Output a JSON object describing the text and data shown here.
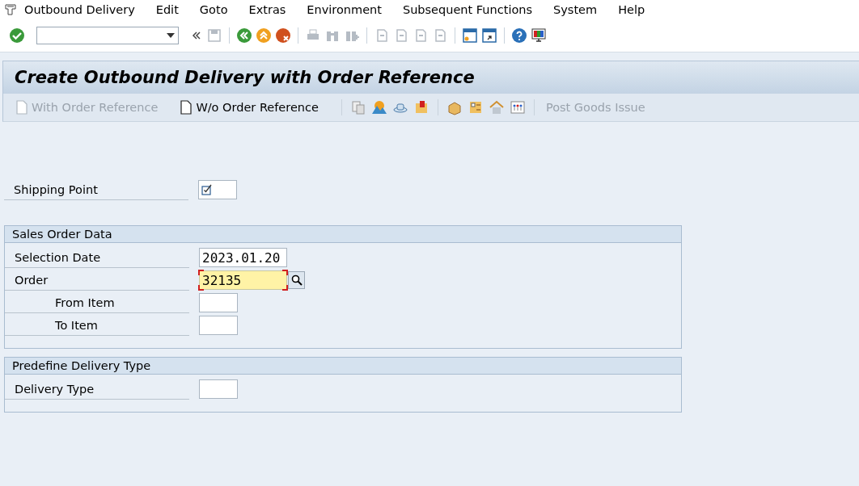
{
  "menu": [
    {
      "label": "Outbound Delivery"
    },
    {
      "label": "Edit"
    },
    {
      "label": "Goto"
    },
    {
      "label": "Extras"
    },
    {
      "label": "Environment"
    },
    {
      "label": "Subsequent Functions"
    },
    {
      "label": "System"
    },
    {
      "label": "Help"
    }
  ],
  "title": "Create Outbound Delivery with Order Reference",
  "app_toolbar": [
    {
      "label": "With Order Reference",
      "disabled": true
    },
    {
      "label": "W/o Order Reference",
      "disabled": false
    },
    {
      "label": "Post Goods Issue",
      "disabled": true
    }
  ],
  "shipping_point": {
    "label": "Shipping Point",
    "required": true
  },
  "groups": [
    {
      "title": "Sales Order Data",
      "fields": [
        {
          "label": "Selection Date",
          "value": "2023.01.20",
          "indented": false,
          "focused": false,
          "search_help": false,
          "wide": true
        },
        {
          "label": "Order",
          "value": "32135",
          "indented": false,
          "focused": true,
          "search_help": true,
          "wide": true
        },
        {
          "label": "From Item",
          "indented": true,
          "focused": false,
          "search_help": false,
          "wide": false
        },
        {
          "label": "To Item",
          "indented": true,
          "focused": false,
          "search_help": false,
          "wide": false
        }
      ]
    },
    {
      "title": "Predefine Delivery Type",
      "fields": [
        {
          "label": "Delivery Type",
          "indented": false,
          "focused": false,
          "search_help": false,
          "wide": false
        }
      ]
    }
  ]
}
